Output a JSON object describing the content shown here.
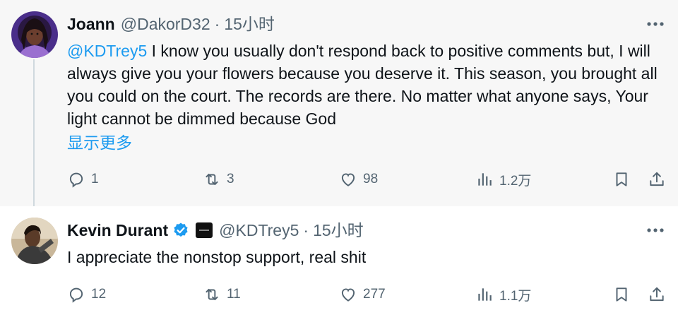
{
  "tweets": [
    {
      "author_name": "Joann",
      "handle": "@DakorD32",
      "separator": "·",
      "time": "15小时",
      "mention": "@KDTrey5",
      "text": " I know you usually don't respond back to positive comments but, I will always give you your flowers because you deserve it. This season, you brought all you could on the court. The records are there. No matter what anyone says, Your light cannot be dimmed because God",
      "show_more": "显示更多",
      "replies": "1",
      "retweets": "3",
      "likes": "98",
      "views": "1.2万"
    },
    {
      "author_name": "Kevin Durant",
      "handle": "@KDTrey5",
      "separator": "·",
      "time": "15小时",
      "text": "I appreciate the nonstop support, real shit",
      "replies": "12",
      "retweets": "11",
      "likes": "277",
      "views": "1.1万"
    }
  ],
  "colors": {
    "accent": "#1d9bf0",
    "muted": "#536471",
    "thread_bg": "#f7f7f7",
    "verified": "#1d9bf0"
  },
  "icons": {
    "reply": "comment-icon",
    "retweet": "retweet-icon",
    "like": "heart-icon",
    "views": "analytics-icon",
    "bookmark": "bookmark-icon",
    "share": "share-icon",
    "more": "more-icon"
  }
}
